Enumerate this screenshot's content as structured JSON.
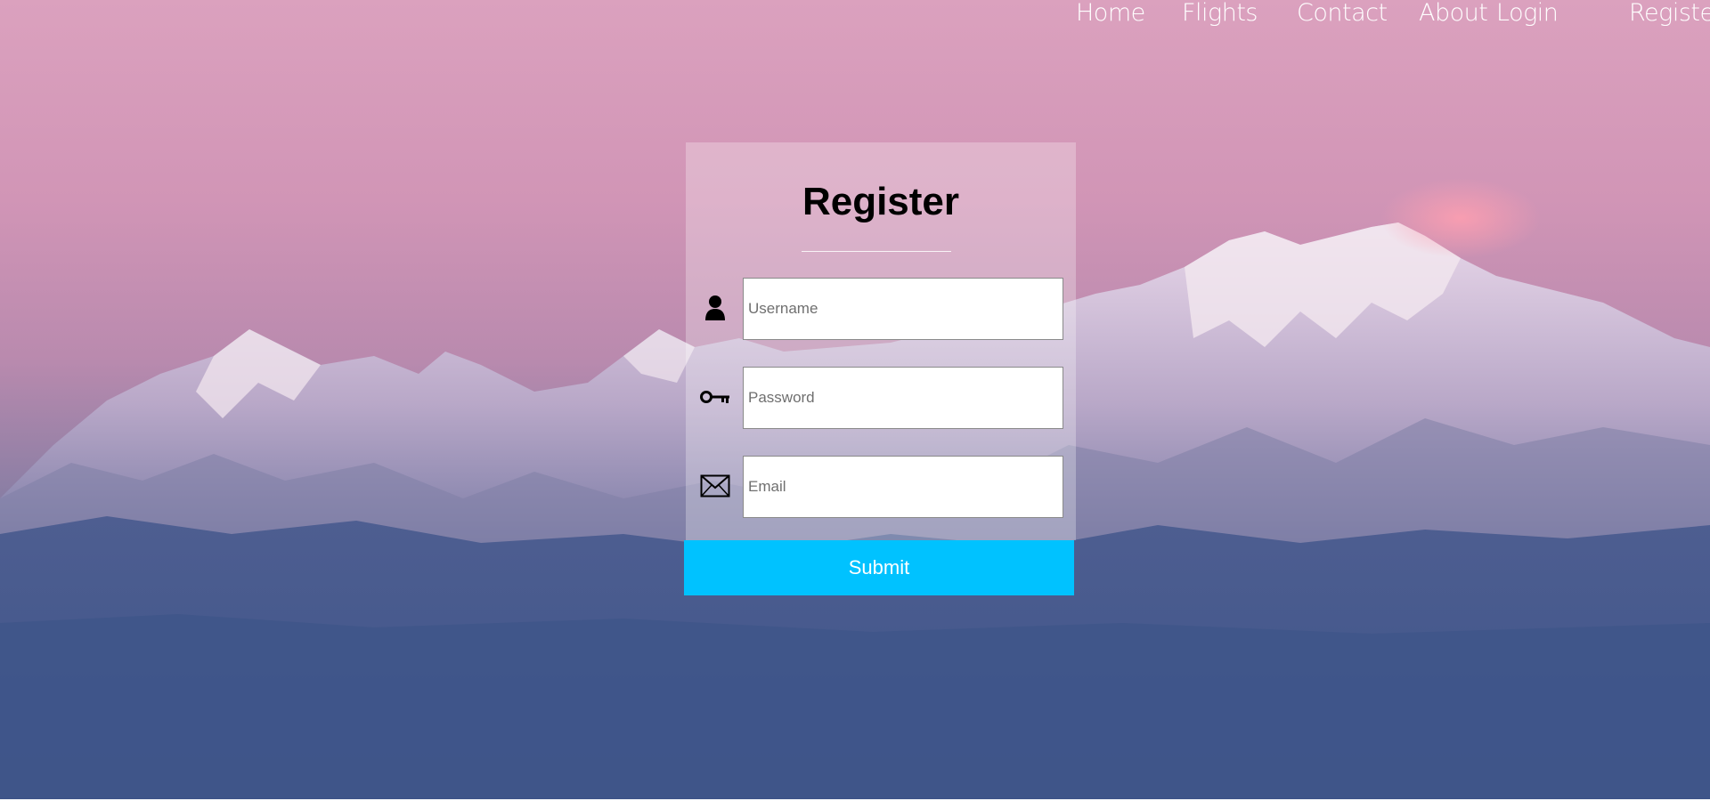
{
  "nav": {
    "items": [
      {
        "label": "Home"
      },
      {
        "label": "Flights"
      },
      {
        "label": "Contact"
      },
      {
        "label": "About"
      },
      {
        "label": "Login"
      },
      {
        "label": "Register"
      }
    ]
  },
  "form": {
    "title": "Register",
    "fields": [
      {
        "icon": "user-icon",
        "placeholder": "Username",
        "value": ""
      },
      {
        "icon": "key-icon",
        "placeholder": "Password",
        "value": ""
      },
      {
        "icon": "envelope-icon",
        "placeholder": "Email",
        "value": ""
      }
    ],
    "submit_label": "Submit"
  },
  "colors": {
    "accent": "#00c2ff",
    "sky_top": "#dba1be",
    "valley": "#40578a"
  }
}
